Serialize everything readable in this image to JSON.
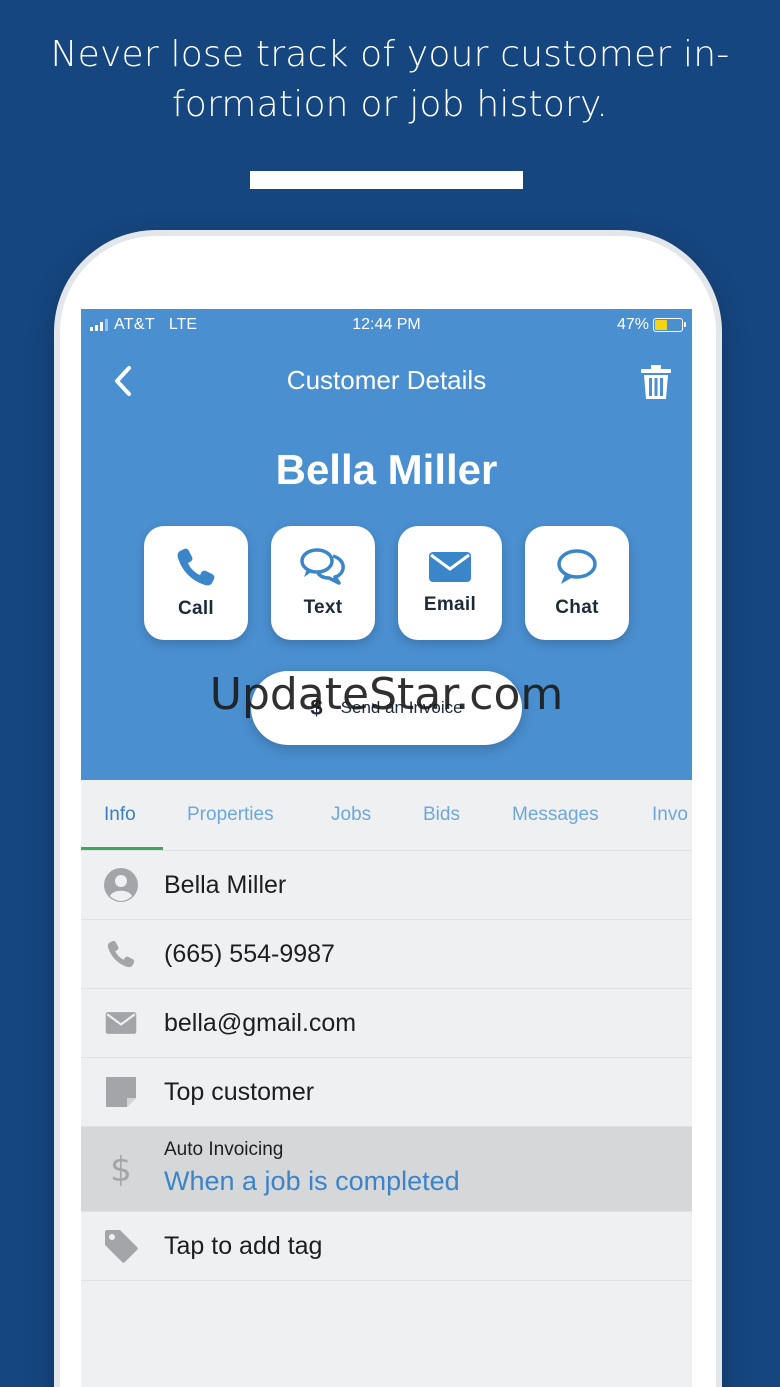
{
  "headline": {
    "line1": "Never lose track of your customer in-",
    "line2": "formation or job history."
  },
  "status_bar": {
    "carrier": "AT&T",
    "network": "LTE",
    "time": "12:44 PM",
    "battery": "47%",
    "battery_level": 0.47
  },
  "nav": {
    "title": "Customer Details",
    "back_icon": "chevron-left-icon",
    "trash_icon": "trash-icon"
  },
  "customer": {
    "name": "Bella Miller"
  },
  "actions": [
    {
      "label": "Call",
      "icon": "phone-icon"
    },
    {
      "label": "Text",
      "icon": "chat-bubbles-icon"
    },
    {
      "label": "Email",
      "icon": "envelope-icon"
    },
    {
      "label": "Chat",
      "icon": "chat-bubble-icon"
    }
  ],
  "invoice_button": {
    "symbol": "$",
    "label": "Send an Invoice"
  },
  "watermark": "UpdateStar.com",
  "tabs": [
    {
      "label": "Info",
      "active": true
    },
    {
      "label": "Properties"
    },
    {
      "label": "Jobs"
    },
    {
      "label": "Bids"
    },
    {
      "label": "Messages"
    },
    {
      "label": "Invo"
    }
  ],
  "info_rows": {
    "name": "Bella Miller",
    "phone": "(665) 554-9987",
    "email": "bella@gmail.com",
    "note": "Top customer",
    "auto_invoicing_title": "Auto Invoicing",
    "auto_invoicing_value": "When a job is completed",
    "tag": "Tap to add tag"
  },
  "colors": {
    "background": "#16467f",
    "hero": "#4a8fd0",
    "tab_active": "#3b7fc2",
    "tab_inactive": "#6ea7d9",
    "tab_underline": "#3da75a",
    "link_blue": "#3b84c9"
  }
}
